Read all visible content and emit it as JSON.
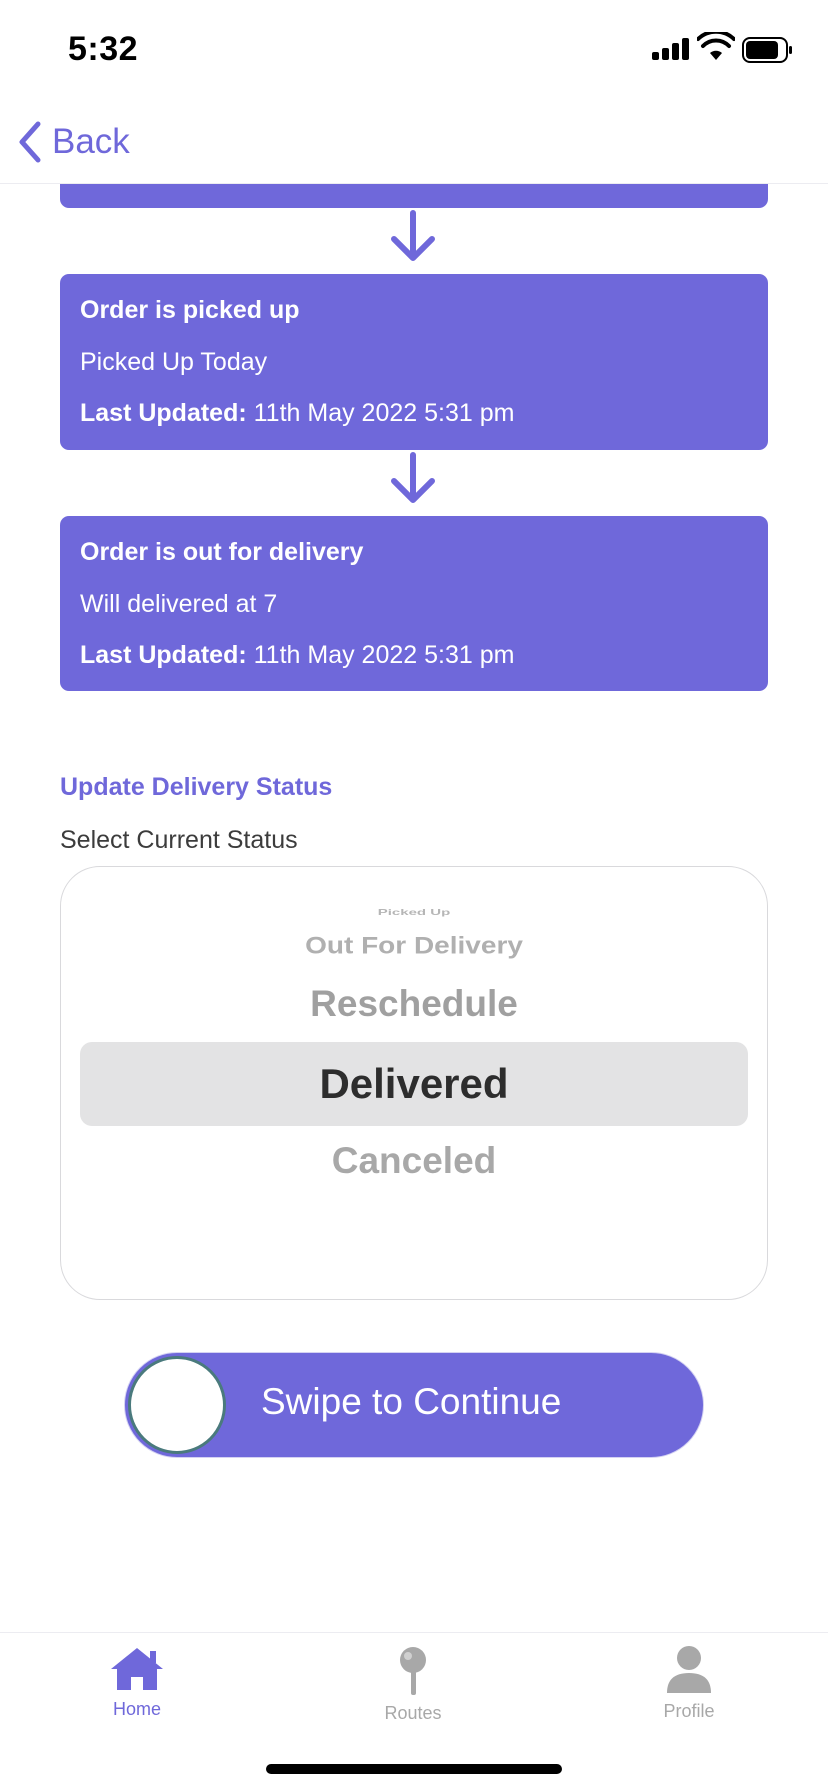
{
  "status_bar": {
    "time": "5:32"
  },
  "nav": {
    "back_label": "Back"
  },
  "timeline": {
    "steps": [
      {
        "title": "Order is picked up",
        "description": "Picked Up Today",
        "updated_label": "Last Updated:",
        "updated_value": " 11th May 2022 5:31 pm"
      },
      {
        "title": "Order is out for delivery",
        "description": "Will delivered at 7",
        "updated_label": "Last Updated:",
        "updated_value": " 11th May 2022 5:31 pm"
      }
    ]
  },
  "update": {
    "section_title": "Update Delivery Status",
    "select_label": "Select Current Status",
    "options": [
      "Picked Up",
      "Out For Delivery",
      "Reschedule",
      "Delivered",
      "Canceled"
    ],
    "selected": "Delivered"
  },
  "swipe": {
    "label": "Swipe to Continue"
  },
  "tab_bar": {
    "tabs": [
      {
        "label": "Home",
        "icon": "home-icon",
        "active": true
      },
      {
        "label": "Routes",
        "icon": "map-pin-icon",
        "active": false
      },
      {
        "label": "Profile",
        "icon": "user-icon",
        "active": false
      }
    ]
  },
  "colors": {
    "accent": "#6f68da",
    "inactive": "#a8a8a8",
    "card_text": "#ffffff"
  }
}
